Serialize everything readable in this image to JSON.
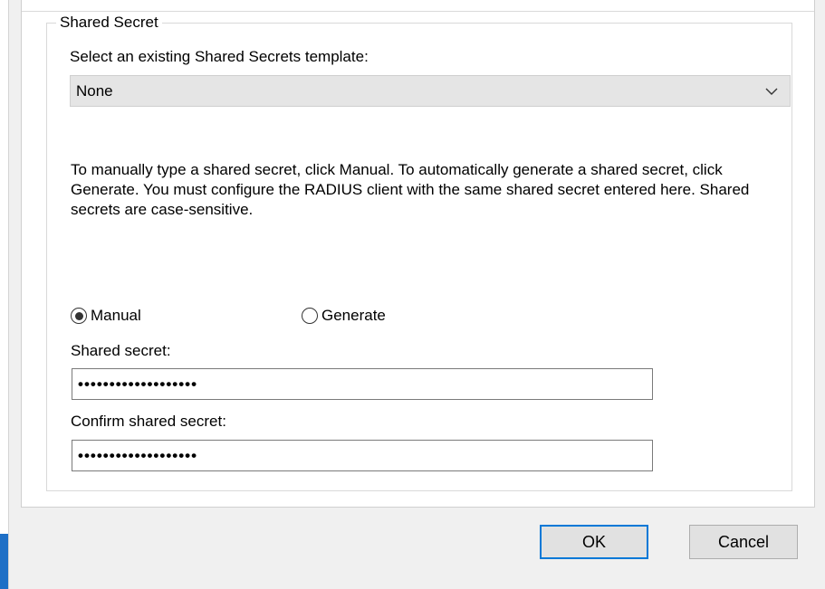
{
  "group": {
    "title": "Shared Secret"
  },
  "template": {
    "label": "Select an existing Shared Secrets template:",
    "selected": "None",
    "chevron_icon": "chevron-down-icon"
  },
  "description": "To manually type a shared secret, click Manual. To automatically generate a shared secret, click Generate. You must configure the RADIUS client with the same shared secret entered here. Shared secrets are case-sensitive.",
  "mode": {
    "manual_label": "Manual",
    "generate_label": "Generate",
    "selected": "Manual"
  },
  "secret": {
    "label": "Shared secret:",
    "value": "•••••••••••••••••••"
  },
  "confirm": {
    "label": "Confirm shared secret:",
    "value": "•••••••••••••••••••"
  },
  "buttons": {
    "ok": "OK",
    "cancel": "Cancel"
  },
  "colors": {
    "accent": "#0078d7",
    "dialog_bg": "#f0f0f0"
  }
}
